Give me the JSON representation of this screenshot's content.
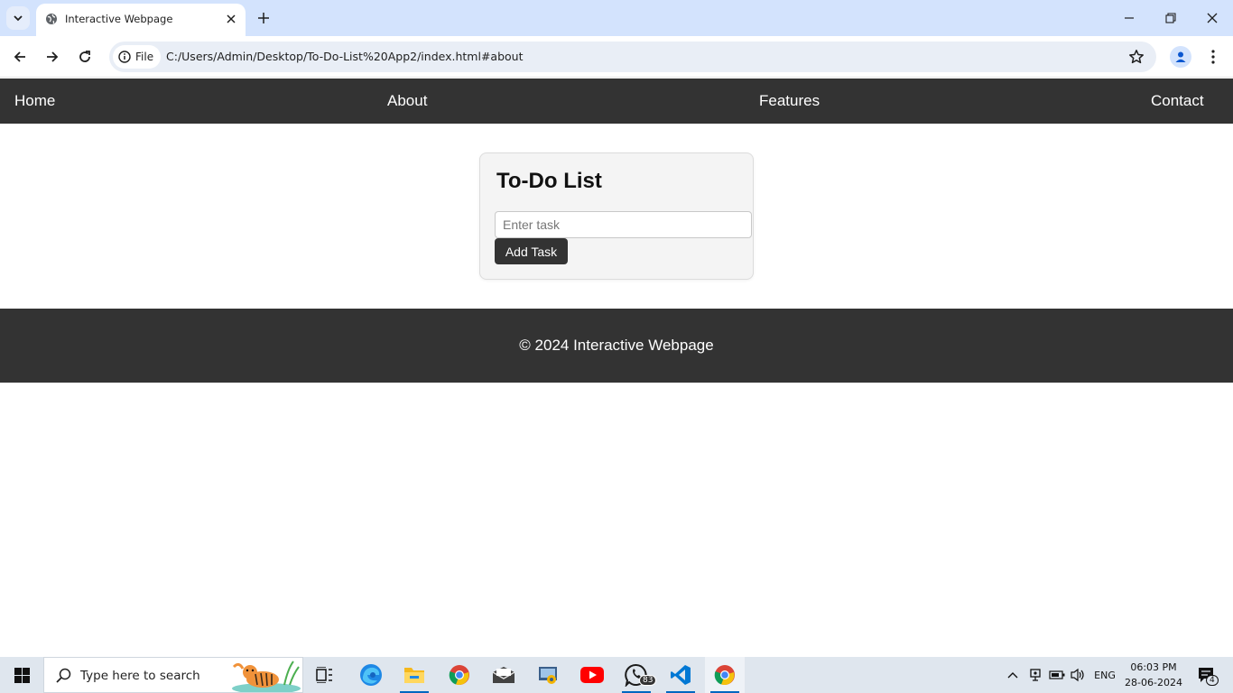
{
  "browser": {
    "tab_title": "Interactive Webpage",
    "site_chip_label": "File",
    "url": "C:/Users/Admin/Desktop/To-Do-List%20App2/index.html#about"
  },
  "page": {
    "nav": {
      "home": "Home",
      "about": "About",
      "features": "Features",
      "contact": "Contact"
    },
    "todo": {
      "title": "To-Do List",
      "input_placeholder": "Enter task",
      "input_value": "",
      "add_button": "Add Task"
    },
    "footer": {
      "text": "© 2024 Interactive Webpage"
    }
  },
  "taskbar": {
    "search_placeholder": "Type here to search",
    "whatsapp_badge": "83",
    "language": "ENG",
    "time": "06:03 PM",
    "date": "28-06-2024",
    "notification_count": "4"
  },
  "colors": {
    "nav_bg": "#333333",
    "footer_bg": "#333333",
    "card_bg": "#f4f4f4",
    "tabstrip_bg": "#d3e3fd",
    "taskbar_bg": "#dfe6ee"
  }
}
